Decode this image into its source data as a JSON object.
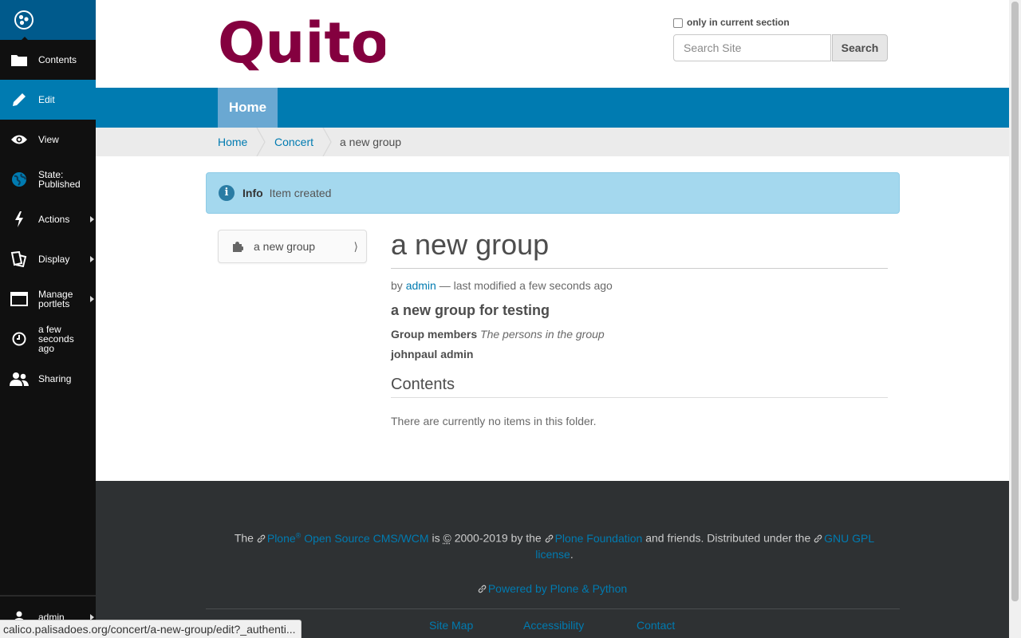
{
  "toolbar": {
    "items": [
      {
        "label": "Contents",
        "icon": "folder-icon"
      },
      {
        "label": "Edit",
        "icon": "pencil-icon"
      },
      {
        "label": "View",
        "icon": "eye-icon"
      },
      {
        "label": "State: Published",
        "icon": "globe-icon"
      },
      {
        "label": "Actions",
        "icon": "bolt-icon"
      },
      {
        "label": "Display",
        "icon": "display-icon"
      },
      {
        "label": "Manage portlets",
        "icon": "window-icon"
      },
      {
        "label": "a few seconds ago",
        "icon": "clock-icon"
      },
      {
        "label": "Sharing",
        "icon": "users-icon"
      }
    ],
    "user": "admin"
  },
  "header": {
    "logo_text": "Quito",
    "brand_color": "#84003f",
    "search_section_label": "only in current section",
    "search_placeholder": "Search Site",
    "search_button": "Search"
  },
  "nav": {
    "home": "Home"
  },
  "breadcrumbs": [
    {
      "label": "Home"
    },
    {
      "label": "Concert"
    },
    {
      "label": "a new group"
    }
  ],
  "status": {
    "title": "Info",
    "message": "Item created"
  },
  "portlet": {
    "item": "a new group"
  },
  "document": {
    "title": "a new group",
    "byline_by": "by",
    "author": "admin",
    "byline_rest": "— last modified a few seconds ago",
    "description": "a new group for testing",
    "field_label": "Group members",
    "field_help": "The persons in the group",
    "members": "johnpaul admin",
    "contents_heading": "Contents",
    "empty_message": "There are currently no items in this folder."
  },
  "footer": {
    "t1": "The",
    "plone": "Plone",
    "reg": "®",
    "cms": "Open Source CMS/WCM",
    "t2": "is",
    "copy": "©",
    "t3": "2000-2019 by the",
    "foundation": "Plone Foundation",
    "t4": "and friends. Distributed under the",
    "license": "GNU GPL license",
    "period": ".",
    "powered": "Powered by Plone & Python",
    "links": [
      "Site Map",
      "Accessibility",
      "Contact"
    ]
  },
  "status_url": "calico.palisadoes.org/concert/a-new-group/edit?_authenti..."
}
